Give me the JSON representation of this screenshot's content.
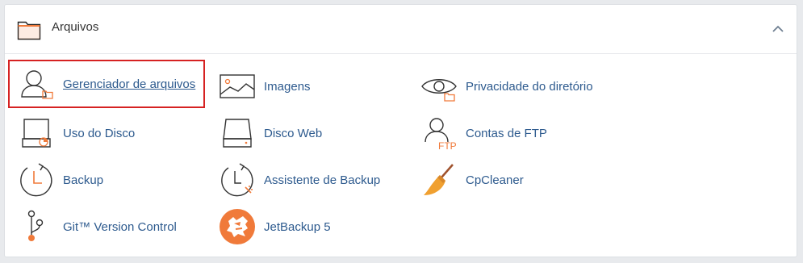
{
  "section": {
    "title": "Arquivos",
    "icon": "folder-icon",
    "collapse_icon": "chevron-up-icon"
  },
  "colors": {
    "link": "#2d5a8e",
    "accent": "#f07a3a",
    "selected_border": "#d62222"
  },
  "items": [
    {
      "label": "Gerenciador de arquivos",
      "icon": "file-manager-icon",
      "selected": true
    },
    {
      "label": "Imagens",
      "icon": "images-icon"
    },
    {
      "label": "Privacidade do diretório",
      "icon": "directory-privacy-icon"
    },
    {
      "label": "Uso do Disco",
      "icon": "disk-usage-icon"
    },
    {
      "label": "Disco Web",
      "icon": "web-disk-icon"
    },
    {
      "label": "Contas de FTP",
      "icon": "ftp-accounts-icon",
      "badge": "FTP"
    },
    {
      "label": "Backup",
      "icon": "backup-icon"
    },
    {
      "label": "Assistente de Backup",
      "icon": "backup-wizard-icon"
    },
    {
      "label": "CpCleaner",
      "icon": "broom-icon"
    },
    {
      "label": "Git™ Version Control",
      "icon": "git-icon"
    },
    {
      "label": "JetBackup 5",
      "icon": "jetbackup-icon"
    }
  ]
}
